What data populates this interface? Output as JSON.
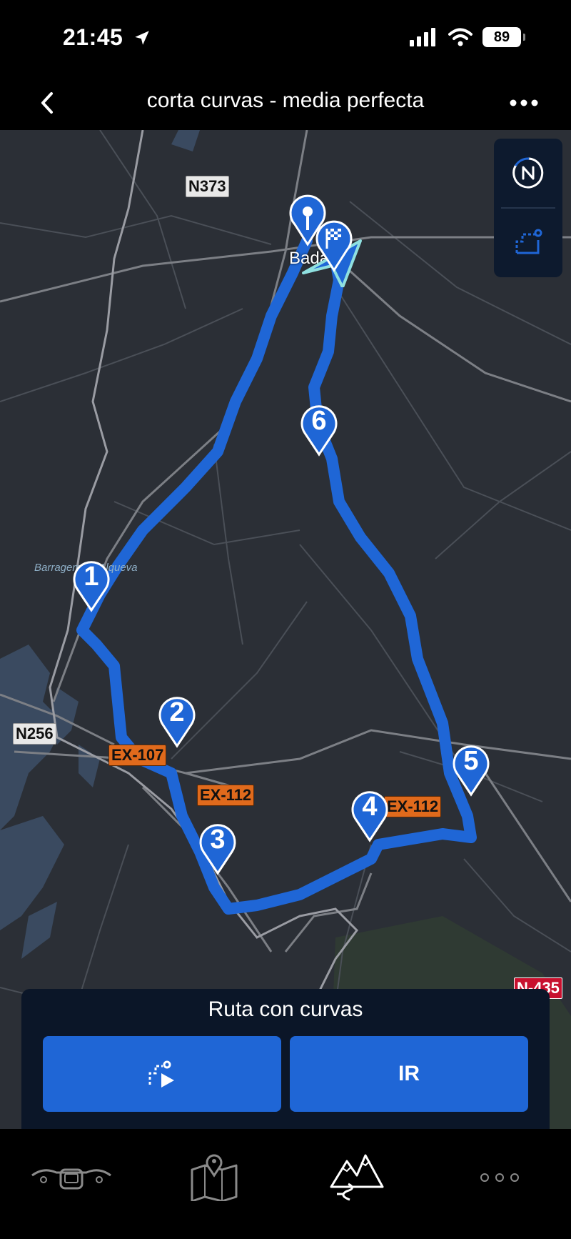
{
  "status_bar": {
    "time": "21:45",
    "battery": "89"
  },
  "nav": {
    "title": "corta curvas - media perfecta"
  },
  "map": {
    "roads": {
      "n373": "N373",
      "n256": "N256",
      "ex107": "EX-107",
      "ex112a": "EX-112",
      "ex112b": "EX-112",
      "n435": "N-435"
    },
    "labels": {
      "lake": "Barragem de Alqueva",
      "city": "Badajoz"
    },
    "waypoints": [
      "1",
      "2",
      "3",
      "4",
      "5",
      "6"
    ],
    "colors": {
      "route": "#1f66d6",
      "land": "#2b2f36",
      "water": "#3a4a60"
    }
  },
  "card": {
    "title": "Ruta con curvas",
    "go_label": "IR"
  },
  "tabs": {
    "active": "routes"
  }
}
